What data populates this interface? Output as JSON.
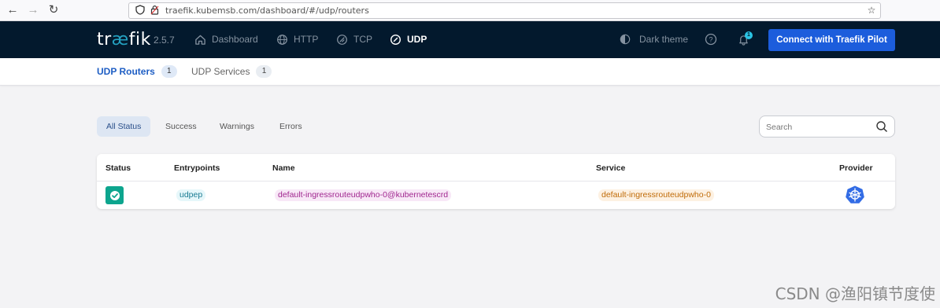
{
  "browser": {
    "url": "traefik.kubemsb.com/dashboard/#/udp/routers"
  },
  "header": {
    "logo_pre": "tr",
    "logo_ae": "æ",
    "logo_post": "fik",
    "version": "2.5.7",
    "nav": [
      {
        "label": "Dashboard",
        "icon": "home-icon"
      },
      {
        "label": "HTTP",
        "icon": "globe-icon"
      },
      {
        "label": "TCP",
        "icon": "tcp-icon"
      },
      {
        "label": "UDP",
        "icon": "udp-icon"
      }
    ],
    "dark_theme_label": "Dark theme",
    "notification_count": "1",
    "pilot_button": "Connect with Traefik Pilot"
  },
  "subnav": {
    "tabs": [
      {
        "label": "UDP Routers",
        "count": "1"
      },
      {
        "label": "UDP Services",
        "count": "1"
      }
    ]
  },
  "filters": {
    "options": [
      "All Status",
      "Success",
      "Warnings",
      "Errors"
    ],
    "search_placeholder": "Search"
  },
  "table": {
    "columns": [
      "Status",
      "Entrypoints",
      "Name",
      "Service",
      "Provider"
    ],
    "rows": [
      {
        "status": "success",
        "entrypoint": "udpep",
        "name": "default-ingressrouteudpwho-0@kubernetescrd",
        "service": "default-ingressrouteudpwho-0",
        "provider": "kubernetes-icon"
      }
    ]
  },
  "colors": {
    "header_bg": "#03192d",
    "accent": "#1c5ddc",
    "success": "#0da58e"
  },
  "watermark": "CSDN @渔阳镇节度使"
}
